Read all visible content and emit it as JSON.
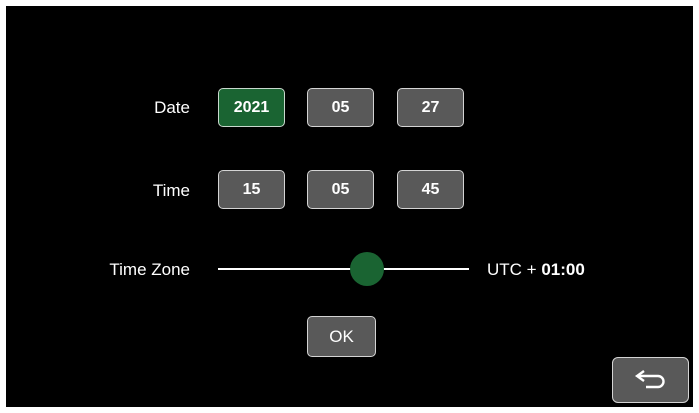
{
  "date": {
    "label": "Date",
    "year": "2021",
    "month": "05",
    "day": "27",
    "selected_field": "year"
  },
  "time": {
    "label": "Time",
    "hour": "15",
    "minute": "05",
    "second": "45"
  },
  "timezone": {
    "label": "Time Zone",
    "prefix": "UTC +",
    "value": "01:00"
  },
  "ok_label": "OK",
  "back_icon": "back-arrow-icon",
  "colors": {
    "background": "#000000",
    "tile": "#595959",
    "selected_tile": "#1a6432",
    "slider_thumb": "#1a6432",
    "text": "#ffffff"
  }
}
